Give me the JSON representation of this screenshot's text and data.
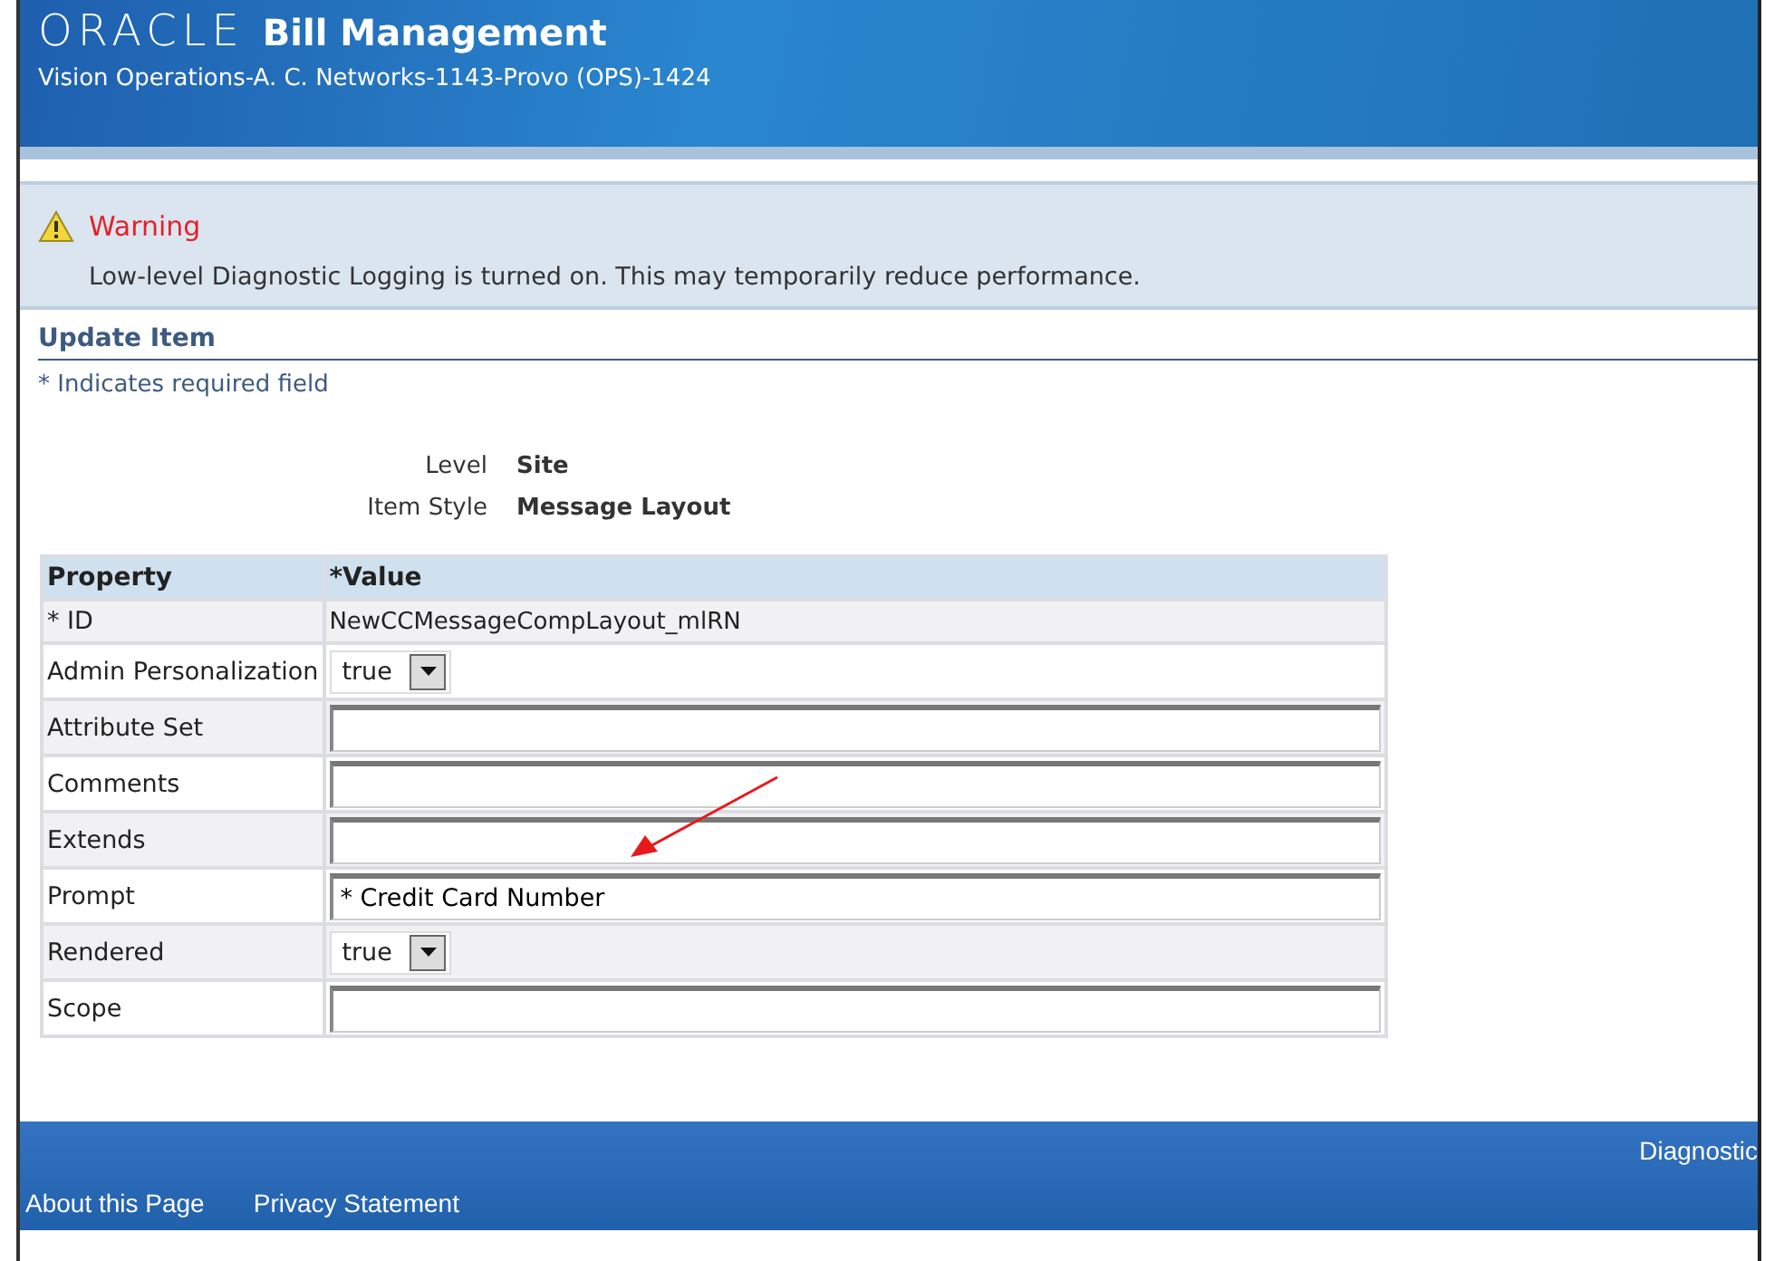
{
  "header": {
    "logo": "ORACLE",
    "product": "Bill Management",
    "context": "Vision Operations-A. C. Networks-1143-Provo (OPS)-1424"
  },
  "warning": {
    "title": "Warning",
    "message": "Low-level Diagnostic Logging is turned on. This may temporarily reduce performance."
  },
  "section": {
    "title": "Update Item",
    "required_note": "* Indicates required field"
  },
  "info": [
    {
      "label": "Level",
      "value": "Site"
    },
    {
      "label": "Item Style",
      "value": "Message Layout"
    }
  ],
  "table": {
    "columns": [
      "Property",
      "*Value"
    ],
    "rows": [
      {
        "property": "* ID",
        "kind": "text",
        "value": "NewCCMessageCompLayout_mlRN"
      },
      {
        "property": "Admin Personalization",
        "kind": "select",
        "value": "true"
      },
      {
        "property": "Attribute Set",
        "kind": "input",
        "value": ""
      },
      {
        "property": "Comments",
        "kind": "input",
        "value": ""
      },
      {
        "property": "Extends",
        "kind": "input",
        "value": ""
      },
      {
        "property": "Prompt",
        "kind": "input",
        "value": "* Credit Card Number"
      },
      {
        "property": "Rendered",
        "kind": "select",
        "value": "true"
      },
      {
        "property": "Scope",
        "kind": "input",
        "value": ""
      }
    ]
  },
  "footer": {
    "global_link": "Diagnostic",
    "links": [
      "About this Page",
      "Privacy Statement"
    ]
  }
}
